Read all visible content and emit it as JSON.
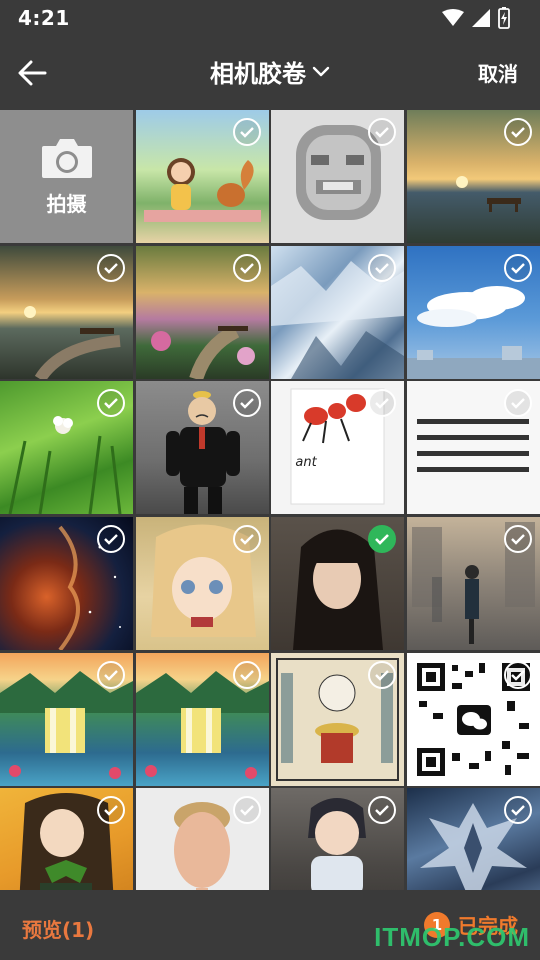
{
  "status": {
    "time": "4:21"
  },
  "header": {
    "title": "相机胶卷",
    "cancel_label": "取消"
  },
  "camera": {
    "label": "拍摄"
  },
  "photos": [
    {
      "subject": "cartoon girl and squirrel picnic",
      "selected": false
    },
    {
      "subject": "pixelated mosaic face",
      "selected": false
    },
    {
      "subject": "lakeside bench sunset check-in card",
      "selected": false
    },
    {
      "subject": "lake sunset check-in card",
      "selected": false
    },
    {
      "subject": "garden path sunset check-in card",
      "selected": false
    },
    {
      "subject": "glacier ice",
      "selected": false
    },
    {
      "subject": "blue sky clouds city",
      "selected": false
    },
    {
      "subject": "green grass with flower",
      "selected": false
    },
    {
      "subject": "cartoon man in black suit",
      "selected": false
    },
    {
      "subject": "red ant illustration card",
      "selected": false
    },
    {
      "subject": "chinese poem text",
      "selected": false
    },
    {
      "subject": "space nebula face",
      "selected": false
    },
    {
      "subject": "anime girl portrait",
      "selected": false
    },
    {
      "subject": "woman portrait",
      "selected": true
    },
    {
      "subject": "people walking city street",
      "selected": false
    },
    {
      "subject": "waterfall landscape with cranes",
      "selected": false
    },
    {
      "subject": "waterfall landscape with cranes",
      "selected": false
    },
    {
      "subject": "straw hat character poster",
      "selected": false
    },
    {
      "subject": "wechat qr code",
      "selected": false
    },
    {
      "subject": "anime girl green bow",
      "selected": false
    },
    {
      "subject": "man portrait",
      "selected": false
    },
    {
      "subject": "anime boy sitting",
      "selected": false
    },
    {
      "subject": "mecha robot",
      "selected": false
    }
  ],
  "photo_texts": {
    "ant": "ant"
  },
  "footer": {
    "preview_label": "预览(1)",
    "done_count": "1",
    "done_label": "已完成",
    "watermark": "ITMOP.COM"
  },
  "colors": {
    "accent": "#f07a2c",
    "selected_check": "#2fb75a"
  }
}
